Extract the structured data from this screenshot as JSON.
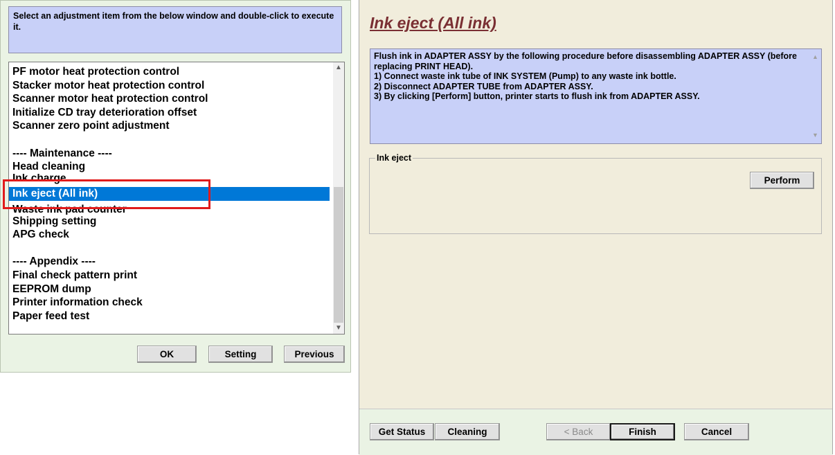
{
  "left": {
    "instruction": "Select an adjustment item from the below window and double-click to execute it.",
    "items": [
      "PF motor heat protection control",
      "Stacker motor heat protection control",
      "Scanner motor heat protection control",
      "Initialize CD tray deterioration offset",
      "Scanner zero point adjustment",
      "",
      "---- Maintenance ----",
      "Head cleaning",
      "Ink charge",
      "Ink eject (All ink)",
      "Waste ink pad counter",
      "Shipping setting",
      "APG check",
      "",
      "---- Appendix ----",
      "Final check pattern print",
      "EEPROM dump",
      "Printer information check",
      "Paper feed test"
    ],
    "buttons": {
      "ok": "OK",
      "setting": "Setting",
      "previous": "Previous"
    },
    "scroll_up_icon": "▲",
    "scroll_down_icon": "▼"
  },
  "right": {
    "title": "Ink eject (All ink)",
    "description": [
      "Flush ink in ADAPTER ASSY by the following procedure before disassembling ADAPTER ASSY (before replacing PRINT HEAD).",
      "1) Connect waste ink tube of INK SYSTEM (Pump) to any waste ink bottle.",
      "2) Disconnect ADAPTER TUBE from ADAPTER ASSY.",
      "3) By clicking [Perform] button, printer starts to flush ink from ADAPTER ASSY."
    ],
    "group_label": "Ink eject",
    "perform_button": "Perform",
    "buttons": {
      "get_status": "Get Status",
      "cleaning": "Cleaning",
      "back": "< Back",
      "finish": "Finish",
      "cancel": "Cancel"
    }
  },
  "colors": {
    "selection": "#0078d7",
    "highlight_box": "#e11b1b",
    "info_panel": "#c8d0f8",
    "heading": "#7a2f33"
  }
}
